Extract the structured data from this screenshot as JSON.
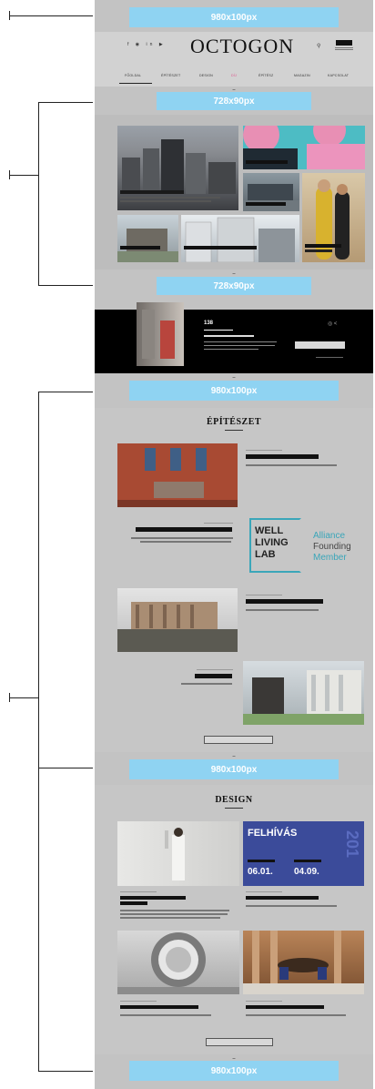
{
  "ads": {
    "top": "980x100px",
    "header_banner": "728x90px",
    "mid_banner": "728x90px",
    "section_banner_1": "980x100px",
    "section_banner_2": "980x100px",
    "bottom_banner": "980x100px"
  },
  "header": {
    "logo": "OCTOGON",
    "social_icons": [
      "facebook-icon",
      "instagram-icon",
      "linkedin-icon",
      "youtube-icon"
    ]
  },
  "nav": {
    "items": [
      "FŐOLDAL",
      "ÉPÍTÉSZET",
      "DESIGN",
      "DÍJ",
      "ÉPÍTÉSZ",
      "MAGAZIN",
      "KAPCSOLAT"
    ],
    "active_index": 0,
    "highlight_index": 3
  },
  "podcast": {
    "number": "138"
  },
  "sections": {
    "architecture": {
      "title": "ÉPÍTÉSZET"
    },
    "design": {
      "title": "DESIGN"
    }
  },
  "well_living": {
    "line1": "WELL",
    "line2": "LIVING",
    "line3": "LAB",
    "alliance1": "Alliance",
    "alliance2": "Founding",
    "alliance3": "Member"
  },
  "design_feature": {
    "title": "FELHÍVÁS",
    "date1": "06.01.",
    "date2": "04.09.",
    "year": "201"
  },
  "colors": {
    "ad_blue": "#8fd3f2",
    "page_gray": "#c3c3c3",
    "nav_pink": "#e0508a",
    "wll_teal": "#3aa6b9"
  }
}
